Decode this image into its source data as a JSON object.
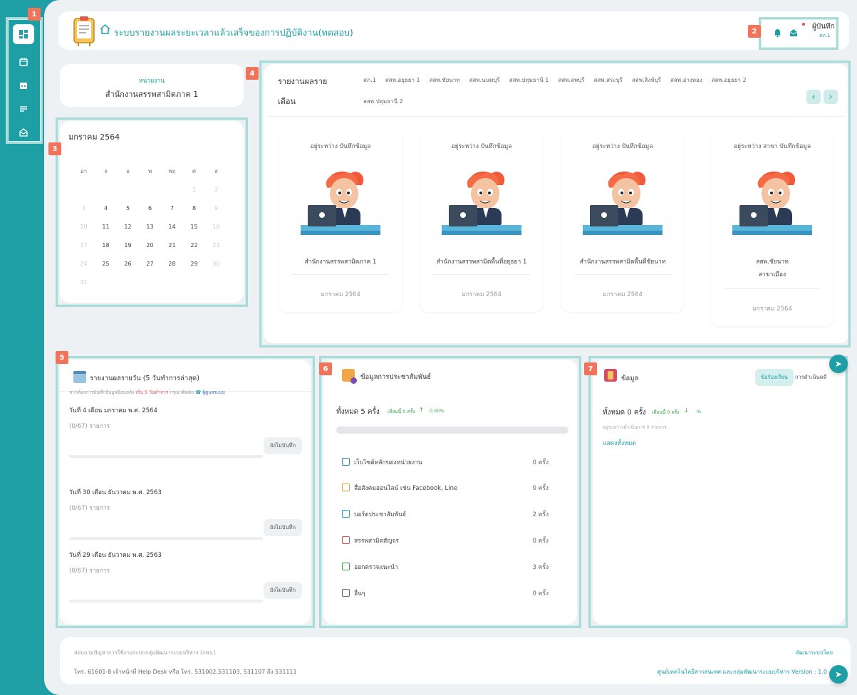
{
  "header": {
    "title": "ระบบรายงานผลระยะเวลาแล้วเสร็จของการปฏิบัติงาน(ทดสอบ)",
    "user_role": "ผู้บันทึก",
    "user_unit": "สภ.1"
  },
  "badges": [
    "1",
    "2",
    "3",
    "4",
    "5",
    "6",
    "7"
  ],
  "unit": {
    "label": "หน่วยงาน",
    "name": "สำนักงานสรรพสามิตภาค 1"
  },
  "calendar": {
    "month_label": "มกราคม 2564",
    "weekdays": [
      "อา",
      "จ",
      "อ",
      "พ",
      "พฤ",
      "ศ",
      "ส"
    ],
    "days": [
      {
        "d": "",
        "dim": true
      },
      {
        "d": "",
        "dim": true
      },
      {
        "d": "",
        "dim": true
      },
      {
        "d": "",
        "dim": true
      },
      {
        "d": "",
        "dim": true
      },
      {
        "d": "1",
        "dim": true
      },
      {
        "d": "2",
        "dim": true
      },
      {
        "d": "3",
        "dim": true
      },
      {
        "d": "4"
      },
      {
        "d": "5"
      },
      {
        "d": "6"
      },
      {
        "d": "7"
      },
      {
        "d": "8"
      },
      {
        "d": "9",
        "dim": true
      },
      {
        "d": "10",
        "dim": true
      },
      {
        "d": "11"
      },
      {
        "d": "12"
      },
      {
        "d": "13"
      },
      {
        "d": "14"
      },
      {
        "d": "15"
      },
      {
        "d": "16",
        "dim": true
      },
      {
        "d": "17",
        "dim": true
      },
      {
        "d": "18"
      },
      {
        "d": "19"
      },
      {
        "d": "20"
      },
      {
        "d": "21"
      },
      {
        "d": "22"
      },
      {
        "d": "23",
        "dim": true
      },
      {
        "d": "24",
        "dim": true
      },
      {
        "d": "25"
      },
      {
        "d": "26"
      },
      {
        "d": "27"
      },
      {
        "d": "28"
      },
      {
        "d": "29"
      },
      {
        "d": "30",
        "dim": true
      },
      {
        "d": "31",
        "dim": true
      }
    ]
  },
  "monthly": {
    "title_line1": "รายงานผลราย",
    "title_line2": "เดือน",
    "tabs_row1": [
      "สภ.1",
      "สสพ.อยุธยา 1",
      "สสพ.ชัยนาท",
      "สสพ.นนทบุรี",
      "สสพ.ปทุมธานี 1",
      "สสพ.ลพบุรี",
      "สสพ.สระบุรี",
      "สสพ.สิงห์บุรี",
      "สสพ.อ่างทอง",
      "สสพ.อยุธยา 2"
    ],
    "tabs_row2": [
      "สสพ.ปทุมธานี 2"
    ],
    "prev": "‹",
    "next": "›",
    "cards": [
      {
        "status": "อยู่ระหว่าง บันทึกข้อมูล",
        "name": "สำนักงานสรรพสามิตภาค 1",
        "name2": "",
        "date": "มกราคม 2564"
      },
      {
        "status": "อยู่ระหว่าง บันทึกข้อมูล",
        "name": "สำนักงานสรรพสามิตพื้นที่อยุธยา 1",
        "name2": "",
        "date": "มกราคม 2564"
      },
      {
        "status": "อยู่ระหว่าง บันทึกข้อมูล",
        "name": "สำนักงานสรรพสามิตพื้นที่ชัยนาท",
        "name2": "",
        "date": "มกราคม 2564"
      },
      {
        "status": "อยู่ระหว่าง สาขา บันทึกข้อมูล",
        "name": "สสพ.ชัยนาท",
        "name2": "สาขาเมือง",
        "date": "มกราคม 2564"
      }
    ]
  },
  "daily": {
    "title": "รายงานผลรายวัน (5 วันทำการล่าสุด)",
    "note_pre": "หากต้องการบันทึกข้อมูลย้อนหลัง",
    "note_red": "เกิน 5 วันทำการ",
    "note_mid": "กรุณาติดต่อ",
    "note_blue": "ผู้ดูแลระบบ",
    "entries": [
      {
        "date": "วันที่ 4 เดือน มกราคม พ.ศ. 2564",
        "count": "(0/67) รายการ",
        "btn": "ยังไม่บันทึก"
      },
      {
        "date": "วันที่ 30 เดือน ธันวาคม พ.ศ. 2563",
        "count": "(0/67) รายการ",
        "btn": "ยังไม่บันทึก"
      },
      {
        "date": "วันที่ 29 เดือน ธันวาคม พ.ศ. 2563",
        "count": "(0/67) รายการ",
        "btn": "ยังไม่บันทึก"
      }
    ]
  },
  "pr": {
    "title": "ข้อมูลการประชาสัมพันธ์",
    "total": "ทั้งหมด 5 ครั้ง",
    "delta": "เดือนนี้ 0 ครั้ง",
    "pct": "0.00%",
    "progress": 0,
    "rows": [
      {
        "label": "เว็บไซต์หลักของหน่วยงาน",
        "value": "0 ครั้ง",
        "color": "#2a8fc9"
      },
      {
        "label": "สื่อสังคมออนไลน์ เช่น Facebook, Line",
        "value": "0 ครั้ง",
        "color": "#e8a23a"
      },
      {
        "label": "บอร์ดประชาสัมพันธ์",
        "value": "2 ครั้ง",
        "color": "#2aa3c9"
      },
      {
        "label": "สรรพสามิตสัญจร",
        "value": "0 ครั้ง",
        "color": "#e05050"
      },
      {
        "label": "ออกตรวจแนะนำ",
        "value": "3 ครั้ง",
        "color": "#3aa84a"
      },
      {
        "label": "อื่นๆ",
        "value": "0 ครั้ง",
        "color": "#666666"
      }
    ]
  },
  "info": {
    "title": "ข้อมูล",
    "tab_active": "ข้อร้องเรียน",
    "tab_other": "การดำเนินคดี",
    "total": "ทั้งหมด 0 ครั้ง",
    "delta": "เดือนนี้ 0 ครั้ง",
    "pct": "-%",
    "sub": "อยู่ระหว่างดำเนินการ 0 รายการ",
    "show_all": "แสดงทั้งหมด"
  },
  "footer": {
    "line1": "สอบถามปัญหาการใช้งานระบบกลุ่มพัฒนาระบบบริหาร (กพร.)",
    "line2": "โทร. 61601-8 เจ้าหน้าที่ Help Desk หรือ โทร. 531002,531103, 531107 ถึง 531111",
    "right1": "พัฒนาระบบโดย",
    "right2": "ศูนย์เทคโนโลยีสารสนเทศ และกลุ่มพัฒนาระบบบริหาร Version : 1.0"
  },
  "colors": {
    "accent": "#1e9fa6",
    "badge": "#f0735a",
    "highlight": "#a9dcd8"
  },
  "icons": [
    "dashboard-icon",
    "calendar-icon",
    "calendar-alt-icon",
    "list-icon",
    "mail-open-icon",
    "home-icon",
    "bell-icon",
    "envelope-icon",
    "send-icon"
  ]
}
